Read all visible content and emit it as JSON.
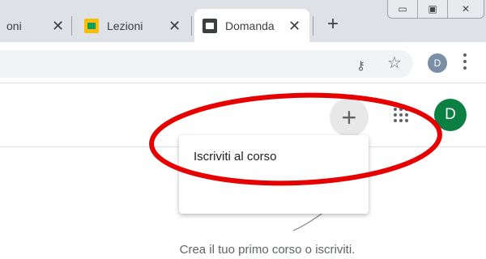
{
  "tabs": [
    {
      "label": "oni",
      "favicon": "none",
      "active": false
    },
    {
      "label": "Lezioni",
      "favicon": "classroom-yellow-icon",
      "active": false
    },
    {
      "label": "Domanda",
      "favicon": "classroom-dark-icon",
      "active": true
    }
  ],
  "tab_close_glyph": "✕",
  "new_tab_glyph": "+",
  "window_controls": {
    "minimize": "▭",
    "maximize": "▣",
    "close": "✕"
  },
  "toolbar": {
    "profile_initial": "D",
    "key_glyph": "⚷",
    "star_glyph": "☆"
  },
  "header": {
    "add_glyph": "+",
    "avatar_initial": "D",
    "avatar_color": "#0b8043"
  },
  "menu": {
    "join_course_label": "Iscriviti al corso"
  },
  "empty_state": {
    "text": "Crea il tuo primo corso o iscriviti."
  },
  "annotation": {
    "color": "#e60000",
    "shape": "ellipse"
  }
}
